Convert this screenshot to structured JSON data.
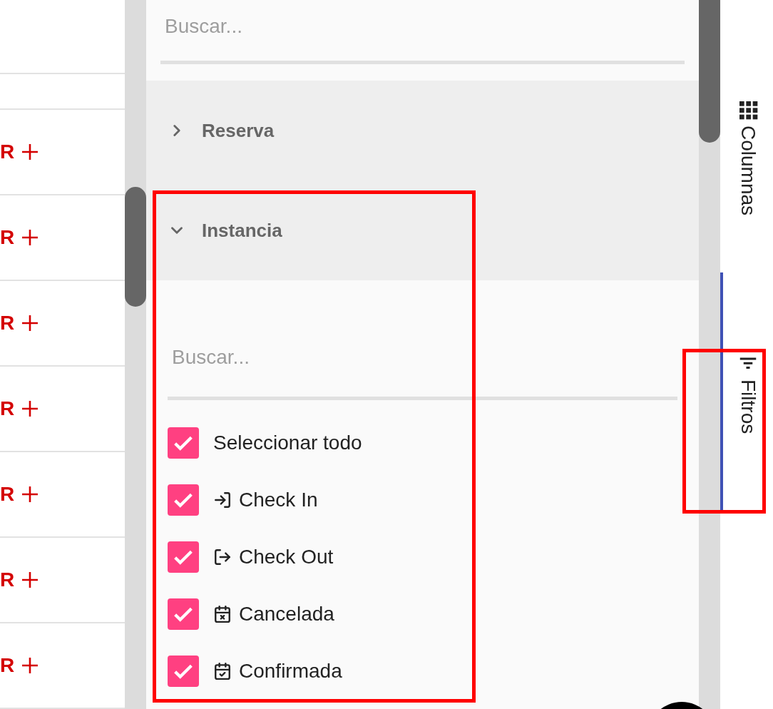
{
  "grid": {
    "rows": [
      {
        "text": "R"
      },
      {
        "text": "R"
      },
      {
        "text": "R"
      },
      {
        "text": "R"
      },
      {
        "text": "R"
      },
      {
        "text": "R"
      },
      {
        "text": "R"
      }
    ]
  },
  "top_search": {
    "placeholder": "Buscar..."
  },
  "groups": [
    {
      "title": "Reserva",
      "expanded": false
    },
    {
      "title": "Instancia",
      "expanded": true,
      "search": {
        "placeholder": "Buscar..."
      },
      "options": [
        {
          "label": "Seleccionar todo",
          "checked": true,
          "kind": "all"
        },
        {
          "label": "Check In",
          "checked": true,
          "kind": "check-in"
        },
        {
          "label": "Check Out",
          "checked": true,
          "kind": "check-out"
        },
        {
          "label": "Cancelada",
          "checked": true,
          "kind": "cancelled"
        },
        {
          "label": "Confirmada",
          "checked": true,
          "kind": "confirmed"
        }
      ]
    }
  ],
  "side_tabs": [
    {
      "label": "Columnas",
      "selected": false,
      "kind": "columns"
    },
    {
      "label": "Filtros",
      "selected": true,
      "kind": "filters"
    }
  ]
}
